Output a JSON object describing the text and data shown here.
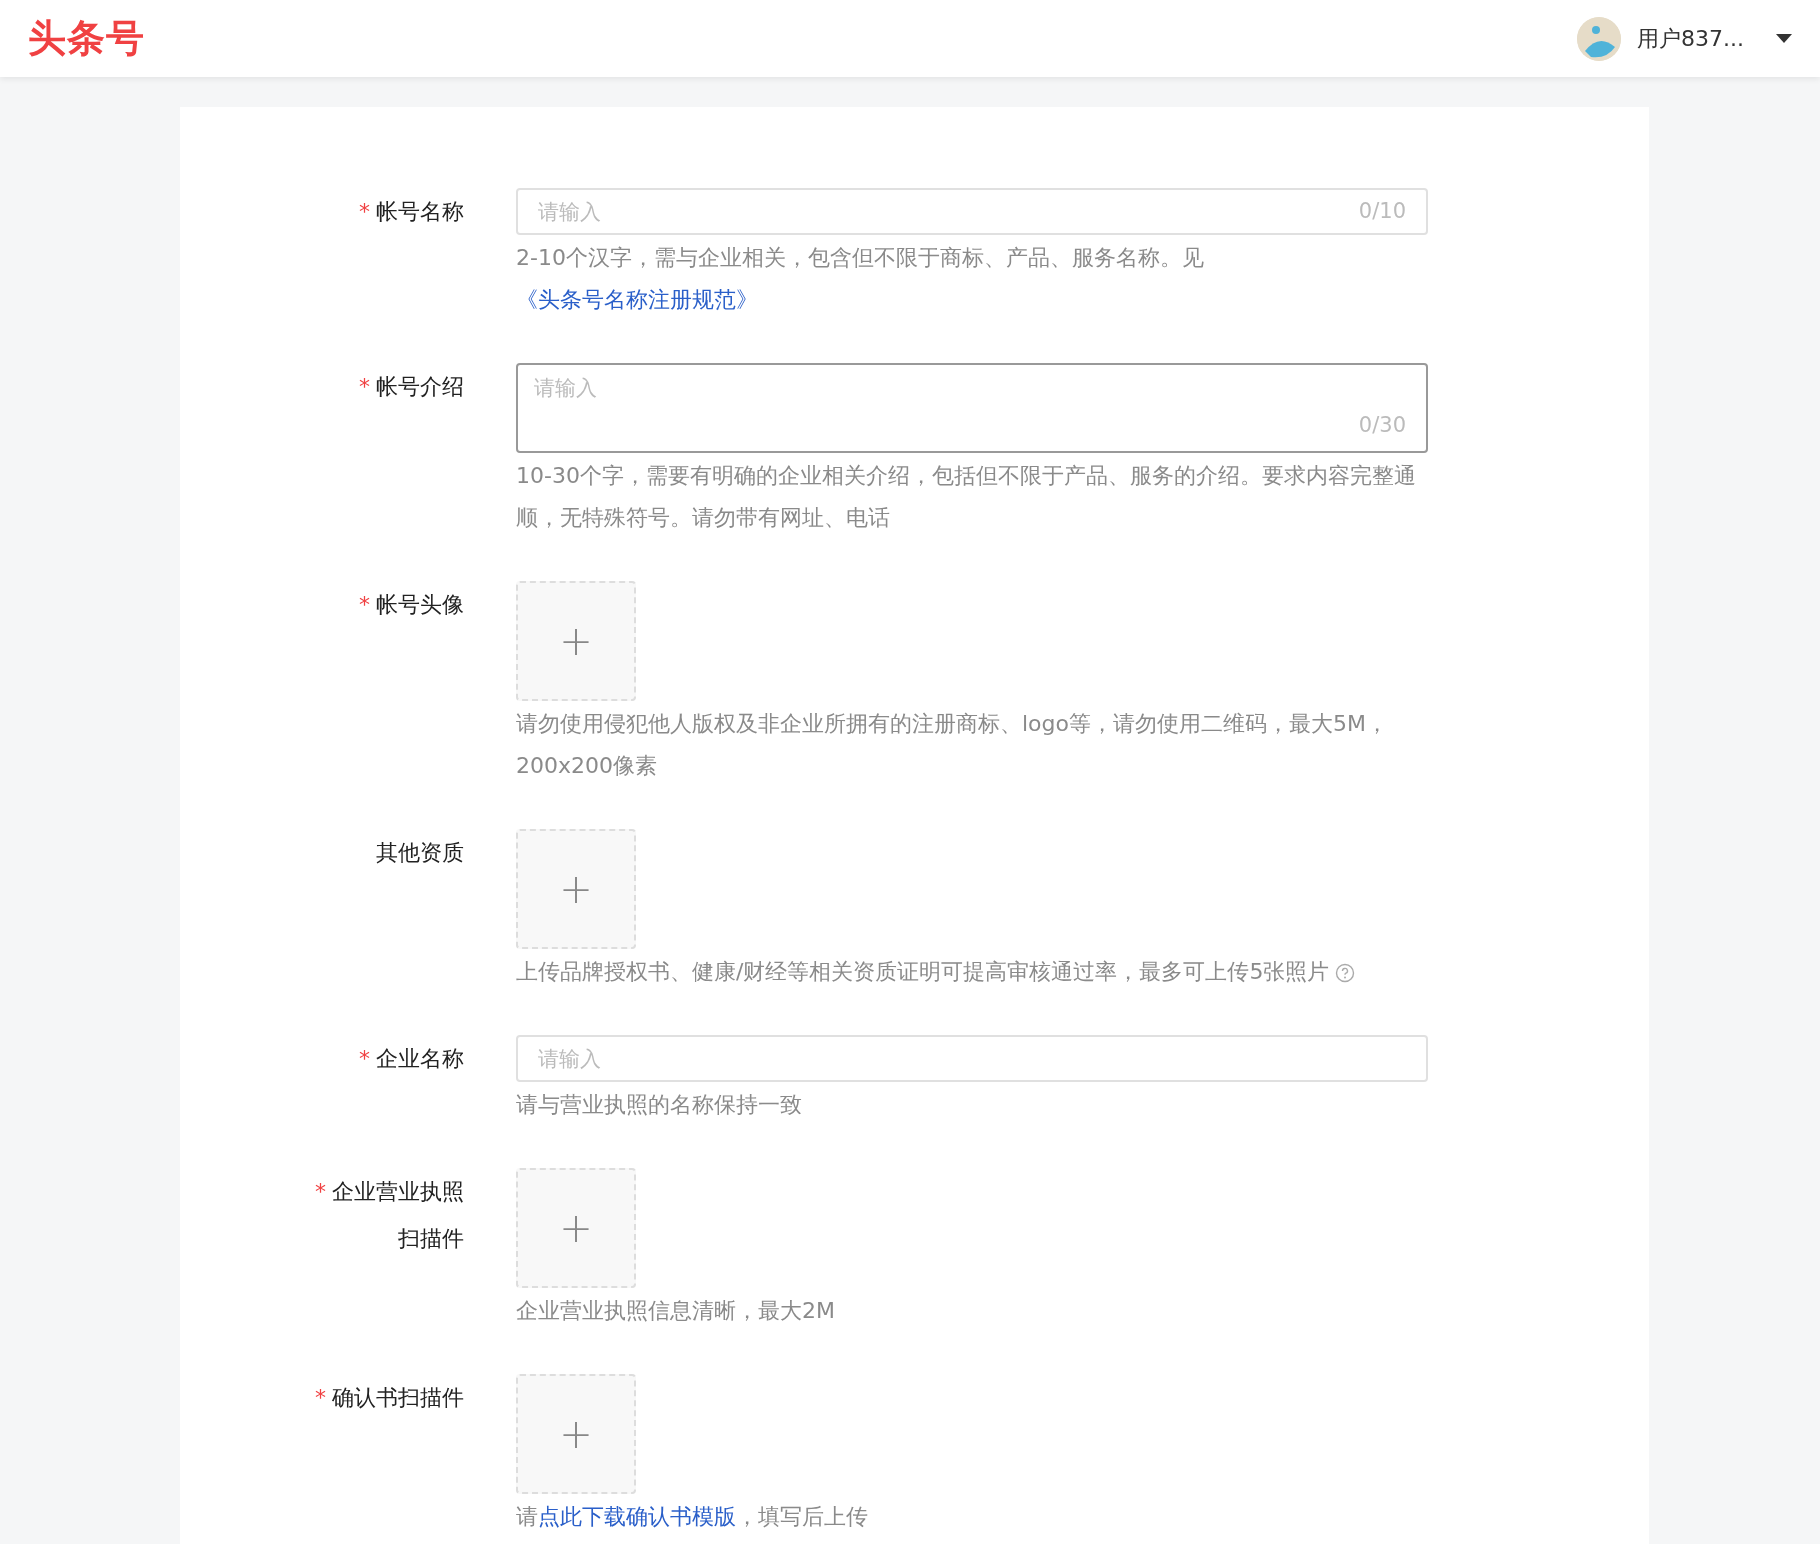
{
  "header": {
    "logo": "头条号",
    "user_name": "用户837..."
  },
  "form": {
    "fields": [
      {
        "kind": "input",
        "required_mark": "*",
        "label": "帐号名称",
        "placeholder": "请输入",
        "counter": "0/10",
        "focused": false,
        "hint": [
          {
            "kind": "plain",
            "text": "2-10个汉字，需与企业相关，包含但不限于商标、产品、服务名称。见"
          },
          {
            "kind": "link",
            "text": "《头条号名称注册规范》"
          }
        ]
      },
      {
        "kind": "textarea",
        "required_mark": "*",
        "label": "帐号介绍",
        "placeholder": "请输入",
        "counter": "0/30",
        "focused": true,
        "hint": [
          {
            "kind": "plain",
            "text": "10-30个字，需要有明确的企业相关介绍，包括但不限于产品、服务的介绍。要求内容完整通顺，无特殊符号。请勿带有网址、电话"
          }
        ]
      },
      {
        "kind": "upload",
        "required_mark": "*",
        "label": "帐号头像",
        "upload_sign": "+",
        "hint": [
          {
            "kind": "plain",
            "text": "请勿使用侵犯他人版权及非企业所拥有的注册商标、logo等，请勿使用二维码，最大5M，200x200像素"
          }
        ]
      },
      {
        "kind": "upload",
        "label": "其他资质",
        "upload_sign": "+",
        "help_icon": true,
        "hint": [
          {
            "kind": "plain",
            "text": "上传品牌授权书、健康/财经等相关资质证明可提高审核通过率，最多可上传5张照片"
          }
        ]
      },
      {
        "kind": "input",
        "required_mark": "*",
        "label": "企业名称",
        "placeholder": "请输入",
        "focused": false,
        "hint": [
          {
            "kind": "plain",
            "text": "请与营业执照的名称保持一致"
          }
        ]
      },
      {
        "kind": "upload",
        "required_mark": "*",
        "label": "企业营业执照扫描件",
        "upload_sign": "+",
        "hint": [
          {
            "kind": "plain",
            "text": "企业营业执照信息清晰，最大2M"
          }
        ]
      },
      {
        "kind": "upload",
        "required_mark": "*",
        "label": "确认书扫描件",
        "upload_sign": "+",
        "hint": [
          {
            "kind": "plain",
            "text": "请"
          },
          {
            "kind": "link",
            "text": "点此下载确认书模版"
          },
          {
            "kind": "plain",
            "text": "，填写后上传"
          }
        ]
      }
    ]
  }
}
